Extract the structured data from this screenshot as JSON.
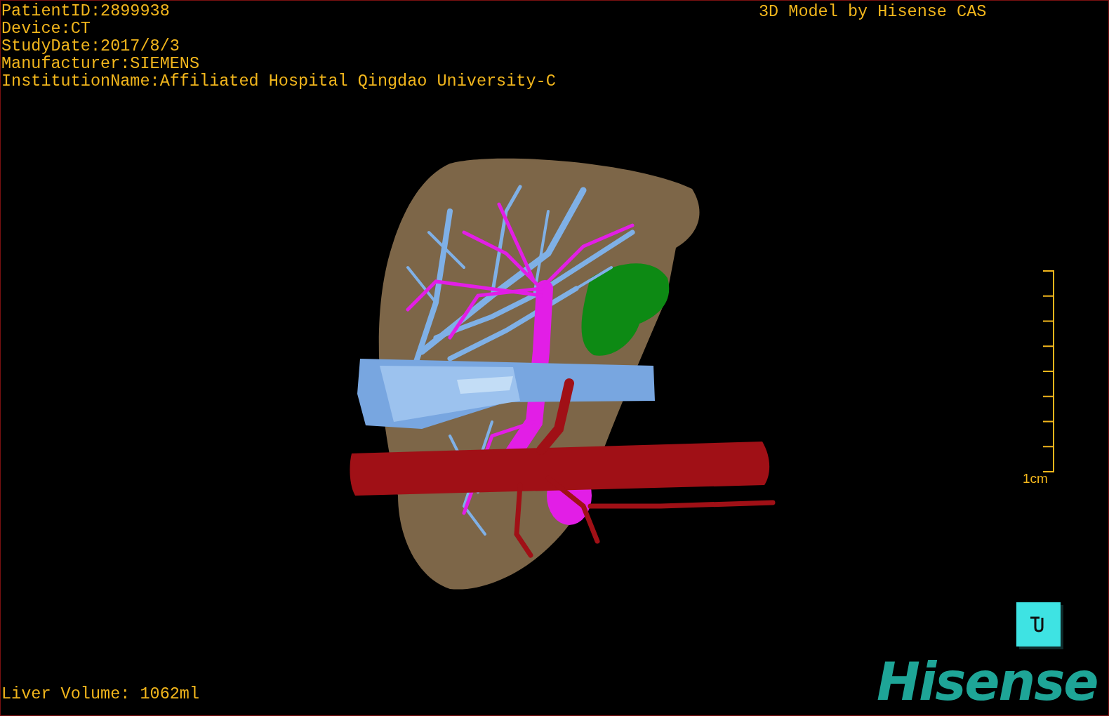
{
  "patient_info": [
    "PatientID:2899938",
    "Device:CT",
    "StudyDate:2017/8/3",
    "Manufacturer:SIEMENS",
    "InstitutionName:Affiliated Hospital Qingdao University-C"
  ],
  "title": "3D Model by Hisense CAS",
  "scale_bar": {
    "label": "1cm"
  },
  "liver_volume": "Liver Volume: 1062ml",
  "logo": "Hisense"
}
